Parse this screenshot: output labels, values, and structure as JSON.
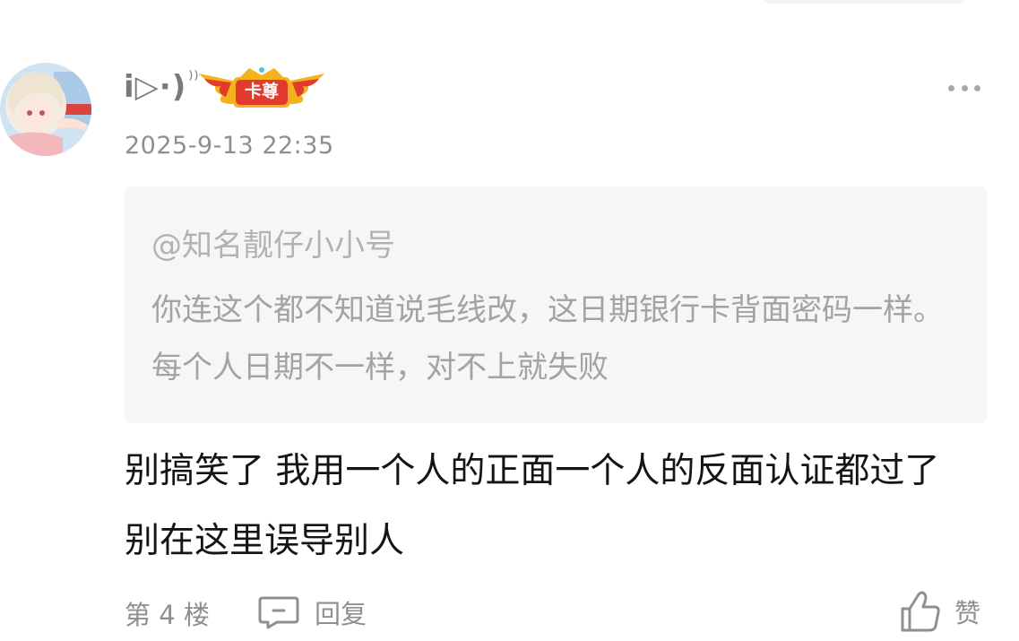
{
  "comment": {
    "username": "i▷·)",
    "username_waves": "))",
    "badge_label": "卡尊",
    "timestamp": "2025-9-13 22:35",
    "quote": {
      "author": "@知名靓仔小小号",
      "text": "你连这个都不知道说毛线改，这日期银行卡背面密码一样。每个人日期不一样，对不上就失败"
    },
    "text": "别搞笑了 我用一个人的正面一个人的反面认证都过了 别在这里误导别人",
    "floor": "第 4 楼",
    "reply_label": "回复",
    "like_label": "赞"
  },
  "icons": {
    "more": "more-dots-icon",
    "reply": "comment-bubble-icon",
    "like": "thumbs-up-icon"
  },
  "colors": {
    "meta_text": "#8f8f8f",
    "quote_background": "#f6f6f6",
    "quote_text": "#a3a3a3",
    "body_text": "#141414",
    "badge_red": "#e23a2c",
    "badge_gold": "#f6b21b"
  }
}
